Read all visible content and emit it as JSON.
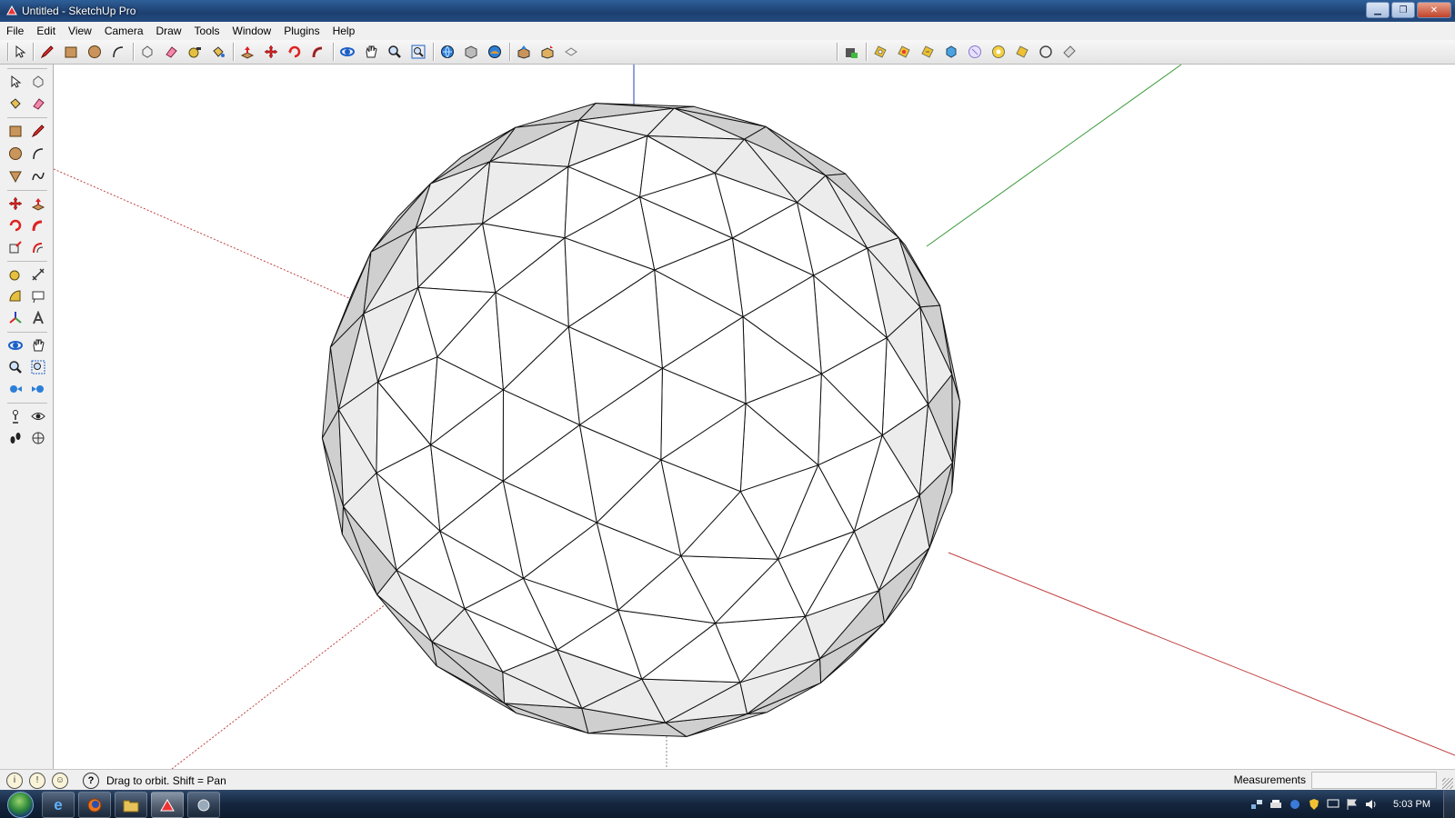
{
  "window": {
    "title": "Untitled - SketchUp Pro"
  },
  "menu": [
    "File",
    "Edit",
    "View",
    "Camera",
    "Draw",
    "Tools",
    "Window",
    "Plugins",
    "Help"
  ],
  "toolbar": {
    "tools": [
      "select-icon",
      "line-pencil-icon",
      "rectangle-icon",
      "circle-icon",
      "arc-icon",
      "make-component-icon",
      "eraser-icon",
      "tape-measure-icon",
      "paint-bucket-icon",
      "push-pull-icon",
      "move-icon",
      "rotate-icon",
      "follow-me-icon",
      "orbit-icon",
      "pan-icon",
      "zoom-icon",
      "zoom-extents-icon",
      "get-models-icon",
      "share-model-icon",
      "add-location-icon",
      "upload-component-icon",
      "send-to-layout-icon",
      "get-photo-texture-icon",
      "extension-warehouse-icon",
      "sandbox-smoove-icon",
      "sandbox-stamp-icon",
      "sandbox-drape-icon",
      "sandbox-add-detail-icon",
      "sandbox-flip-edge-icon",
      "sandbox-from-contours-icon",
      "sandbox-from-scratch-icon",
      "sandbox-circle-icon",
      "sandbox-tag-icon"
    ]
  },
  "status": {
    "hint": "Drag to orbit.  Shift = Pan",
    "measurements_label": "Measurements"
  },
  "taskbar": {
    "clock": "5:03 PM"
  },
  "colors": {
    "axis_red": "#c04040",
    "axis_green": "#3a9a3a",
    "axis_blue": "#2a3fbf",
    "face": "#ffffff",
    "face_shaded": "#cfcfcf",
    "edge": "#111111"
  }
}
